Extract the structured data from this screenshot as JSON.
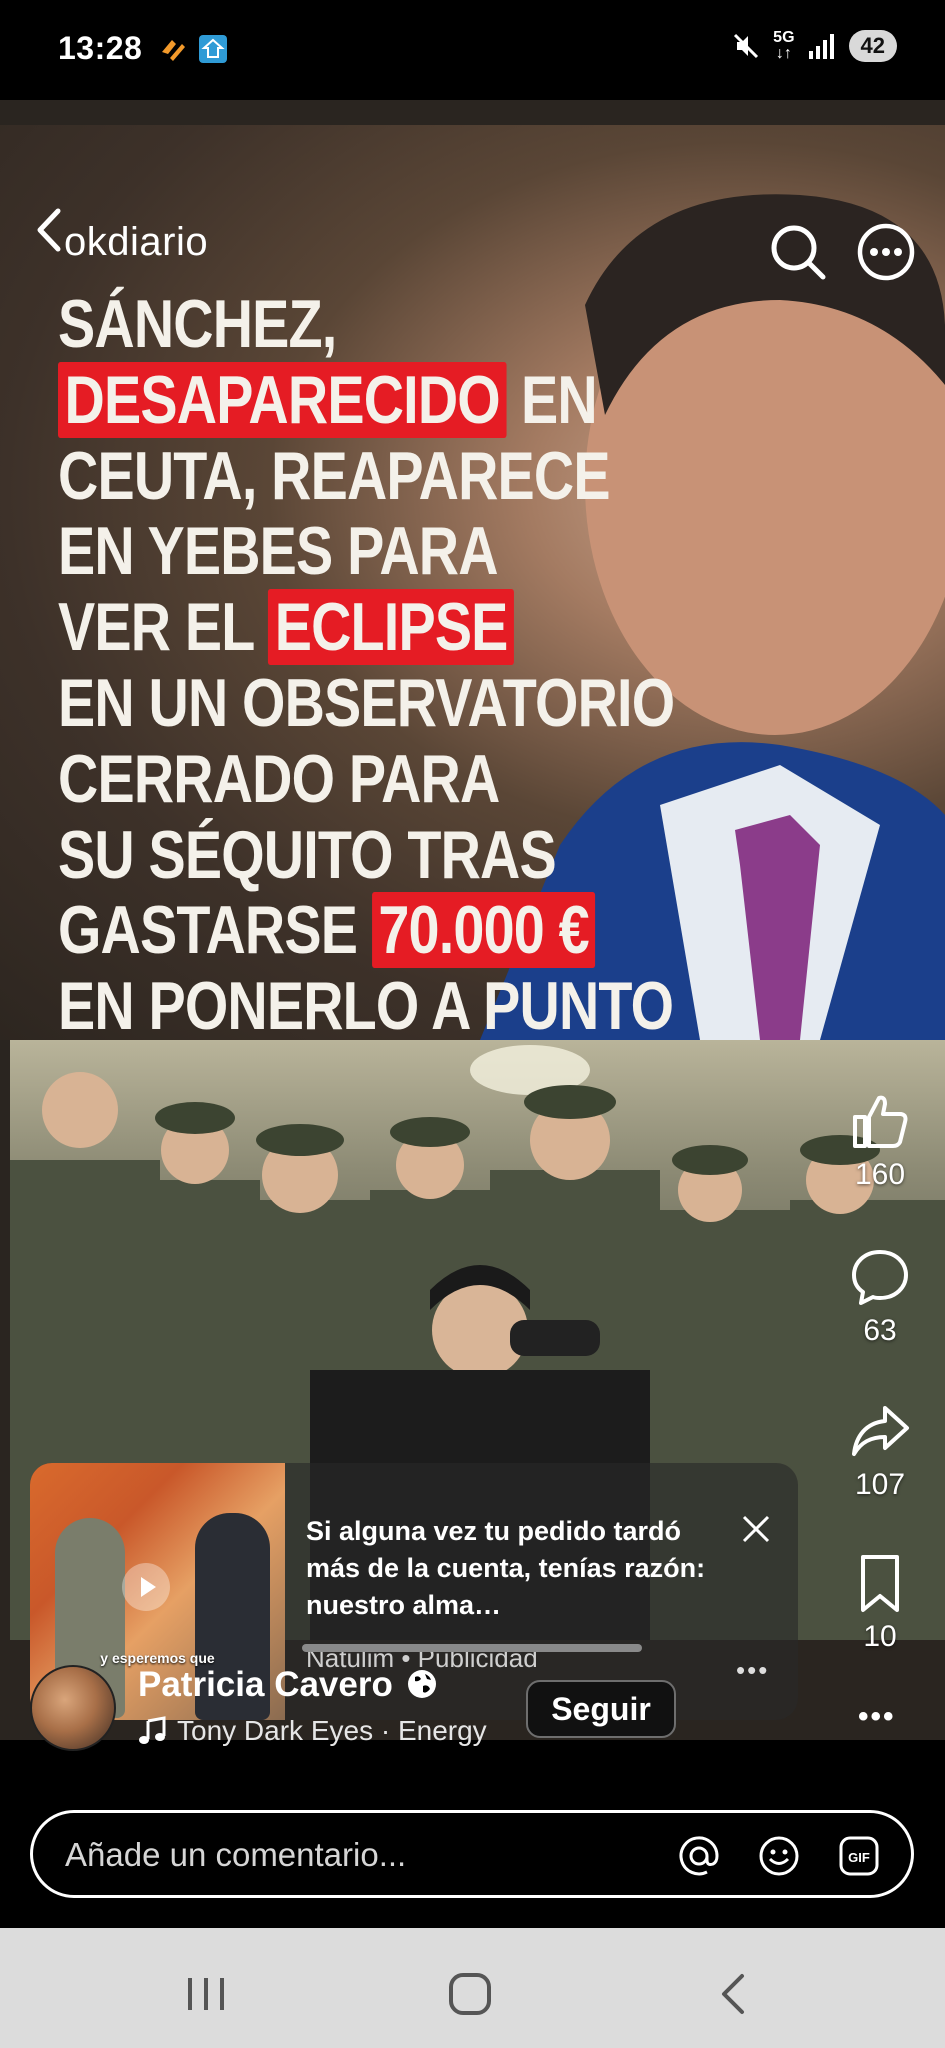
{
  "status_bar": {
    "time": "13:28",
    "network": "5G",
    "battery": "42",
    "icons": [
      "notification-app-icon",
      "location-app-icon",
      "mute-icon",
      "signal-icon"
    ]
  },
  "header": {
    "brand": "okdiario",
    "icons": [
      "back-icon",
      "search-icon",
      "more-icon"
    ]
  },
  "headline": {
    "lines": [
      {
        "before": "SÁNCHEZ,",
        "hl": "",
        "after": ""
      },
      {
        "before": "",
        "hl": "DESAPARECIDO",
        "after": " EN"
      },
      {
        "before": "CEUTA, REAPARECE",
        "hl": "",
        "after": ""
      },
      {
        "before": "EN YEBES PARA",
        "hl": "",
        "after": ""
      },
      {
        "before": "VER EL ",
        "hl": "ECLIPSE",
        "after": ""
      },
      {
        "before": "EN UN OBSERVATORIO",
        "hl": "",
        "after": ""
      },
      {
        "before": "CERRADO PARA",
        "hl": "",
        "after": ""
      },
      {
        "before": "SU SÉQUITO TRAS",
        "hl": "",
        "after": ""
      },
      {
        "before": "GASTARSE ",
        "hl": "70.000 €",
        "after": ""
      },
      {
        "before": "EN PONERLO A PUNTO",
        "hl": "",
        "after": ""
      }
    ],
    "highlight_color": "#e51c24"
  },
  "actions": {
    "likes": "160",
    "comments": "63",
    "shares": "107",
    "saves": "10"
  },
  "ad": {
    "thumb_caption": "y esperemos que",
    "title": "Si alguna vez tu pedido tardó más de la cuenta, tenías razón: nuestro alma…",
    "meta": "Natulim • Publicidad"
  },
  "author": {
    "name": "Patricia Cavero",
    "music": "Tony Dark Eyes · Energy",
    "follow_label": "Seguir"
  },
  "comment": {
    "placeholder": "Añade un comentario..."
  },
  "navbar": {
    "icons": [
      "recent-apps-icon",
      "home-icon",
      "back-nav-icon"
    ]
  }
}
